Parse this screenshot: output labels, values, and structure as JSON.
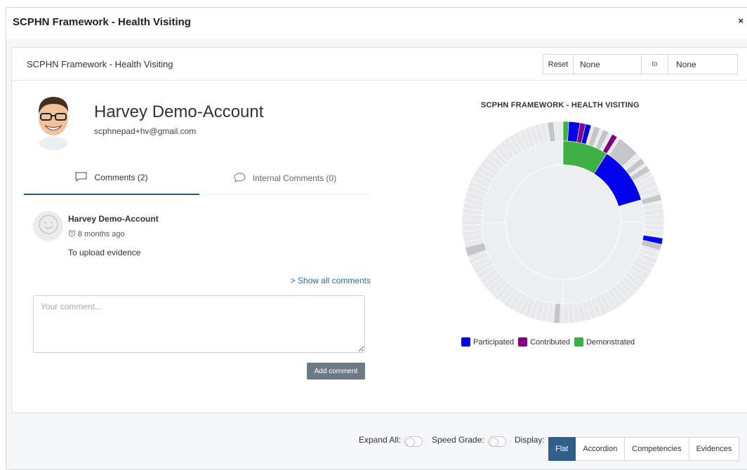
{
  "modal": {
    "title": "SCPHN Framework - Health Visiting",
    "close_label": "×"
  },
  "panel": {
    "title": "SCPHN Framework - Health Visiting",
    "date_range": {
      "reset_label": "Reset",
      "from_value": "None",
      "to_label": "to",
      "until_value": "None"
    }
  },
  "user": {
    "name": "Harvey Demo-Account",
    "email": "scphnepad+hv@gmail.com"
  },
  "tabs": [
    {
      "label": "Comments (2)",
      "icon": "comment-icon",
      "active": true
    },
    {
      "label": "Internal Comments (0)",
      "icon": "comment-outline-icon",
      "active": false
    }
  ],
  "comments": [
    {
      "author": "Harvey Demo-Account",
      "time": "8 months ago",
      "text": "To upload evidence"
    }
  ],
  "show_all_label": "> Show all comments",
  "comment_input": {
    "placeholder": "Your comment...",
    "value": ""
  },
  "add_comment_label": "Add comment",
  "chart_data": {
    "type": "sunburst",
    "title": "SCPHN FRAMEWORK - HEALTH VISITING",
    "legend_placement": "bottom",
    "legend": [
      {
        "name": "Participated",
        "color": "#0000ee"
      },
      {
        "name": "Contributed",
        "color": "#800080"
      },
      {
        "name": "Demonstrated",
        "color": "#3cb043"
      }
    ],
    "inner_ring": [
      {
        "status": "Demonstrated",
        "start_fraction": 0.0,
        "end_fraction": 0.09
      },
      {
        "status": "Participated",
        "start_fraction": 0.09,
        "end_fraction": 0.205
      }
    ],
    "outer_ring_highlights": [
      {
        "status": "Demonstrated",
        "start_fraction": 0.0,
        "end_fraction": 0.009
      },
      {
        "status": "Participated",
        "start_fraction": 0.009,
        "end_fraction": 0.027
      },
      {
        "status": "Contributed",
        "start_fraction": 0.027,
        "end_fraction": 0.036
      },
      {
        "status": "Participated",
        "start_fraction": 0.036,
        "end_fraction": 0.045
      },
      {
        "status": "Contributed",
        "start_fraction": 0.081,
        "end_fraction": 0.09
      },
      {
        "status": "Participated",
        "start_fraction": 0.275,
        "end_fraction": 0.285
      }
    ],
    "outer_ring_grey": [
      {
        "start_fraction": 0.05,
        "end_fraction": 0.06
      },
      {
        "start_fraction": 0.065,
        "end_fraction": 0.075
      },
      {
        "start_fraction": 0.095,
        "end_fraction": 0.13
      },
      {
        "start_fraction": 0.14,
        "end_fraction": 0.15
      },
      {
        "start_fraction": 0.155,
        "end_fraction": 0.165
      },
      {
        "start_fraction": 0.205,
        "end_fraction": 0.215
      },
      {
        "start_fraction": 0.285,
        "end_fraction": 0.295
      },
      {
        "start_fraction": 0.505,
        "end_fraction": 0.515
      },
      {
        "start_fraction": 0.695,
        "end_fraction": 0.71
      },
      {
        "start_fraction": 0.975,
        "end_fraction": 0.985
      }
    ]
  },
  "footer": {
    "expand_all_label": "Expand All:",
    "speed_grade_label": "Speed Grade:",
    "display_label": "Display:",
    "display_options": [
      {
        "label": "Flat",
        "active": true
      },
      {
        "label": "Accordion",
        "active": false
      },
      {
        "label": "Competencies",
        "active": false
      },
      {
        "label": "Evidences",
        "active": false
      }
    ]
  }
}
